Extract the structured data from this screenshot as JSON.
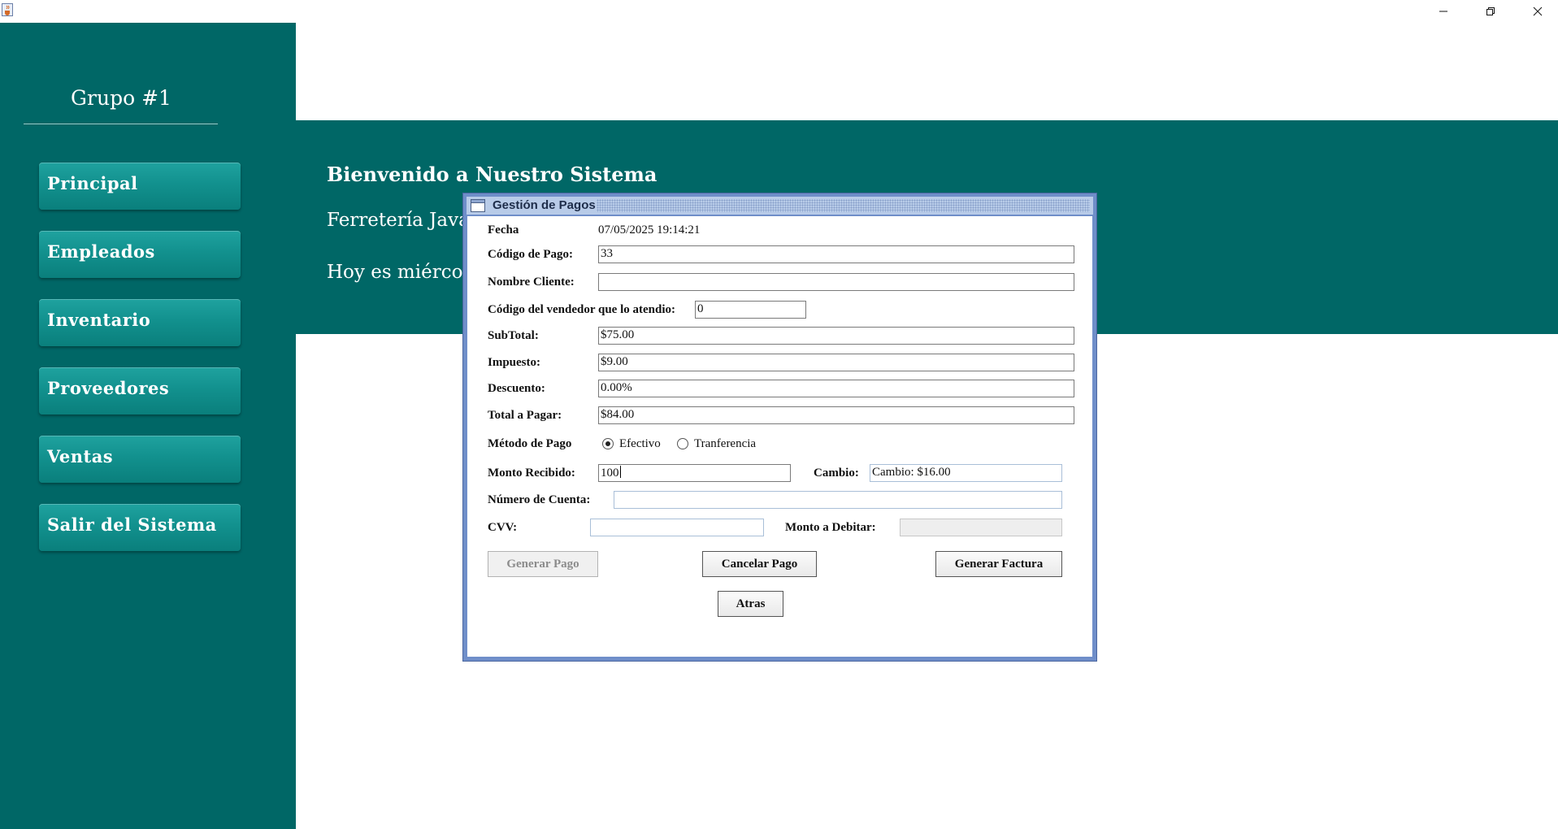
{
  "window": {
    "app_icon": "java-coffee-icon",
    "controls": [
      "minimize-icon",
      "restore-icon",
      "close-icon"
    ]
  },
  "sidebar": {
    "group_title": "Grupo #1",
    "items": [
      {
        "label": "Principal"
      },
      {
        "label": "Empleados"
      },
      {
        "label": "Inventario"
      },
      {
        "label": "Proveedores"
      },
      {
        "label": "Ventas"
      },
      {
        "label": "Salir del Sistema"
      }
    ]
  },
  "header": {
    "welcome": "Bienvenido a Nuestro Sistema",
    "store": "Ferretería Java",
    "today": "Hoy es miércole"
  },
  "dialog": {
    "title": "Gestión de Pagos",
    "fecha_label": "Fecha",
    "fecha_value": "07/05/2025 19:14:21",
    "codigo_pago_label": "Código de Pago:",
    "codigo_pago_value": "33",
    "nombre_cliente_label": "Nombre Cliente:",
    "nombre_cliente_value": "",
    "vendedor_label": "Código del vendedor que lo atendio:",
    "vendedor_value": "0",
    "subtotal_label": "SubTotal:",
    "subtotal_value": "$75.00",
    "impuesto_label": "Impuesto:",
    "impuesto_value": "$9.00",
    "descuento_label": "Descuento:",
    "descuento_value": "0.00%",
    "total_label": "Total a Pagar:",
    "total_value": "$84.00",
    "metodo_label": "Método de Pago",
    "metodo_options": [
      "Efectivo",
      "Tranferencia"
    ],
    "metodo_selected": "Efectivo",
    "monto_label": "Monto Recibido:",
    "monto_value": "100",
    "cambio_label": "Cambio:",
    "cambio_value": "Cambio: $16.00",
    "cuenta_label": "Número de Cuenta:",
    "cuenta_value": "",
    "cvv_label": "CVV:",
    "cvv_value": "",
    "debitar_label": "Monto a Debitar:",
    "debitar_value": "",
    "buttons": {
      "generar_pago": "Generar Pago",
      "cancelar_pago": "Cancelar Pago",
      "generar_factura": "Generar Factura",
      "atras": "Atras"
    }
  },
  "colors": {
    "teal": "#006766",
    "button_teal": "#12918e",
    "dialog_border": "#6f8ec9"
  }
}
